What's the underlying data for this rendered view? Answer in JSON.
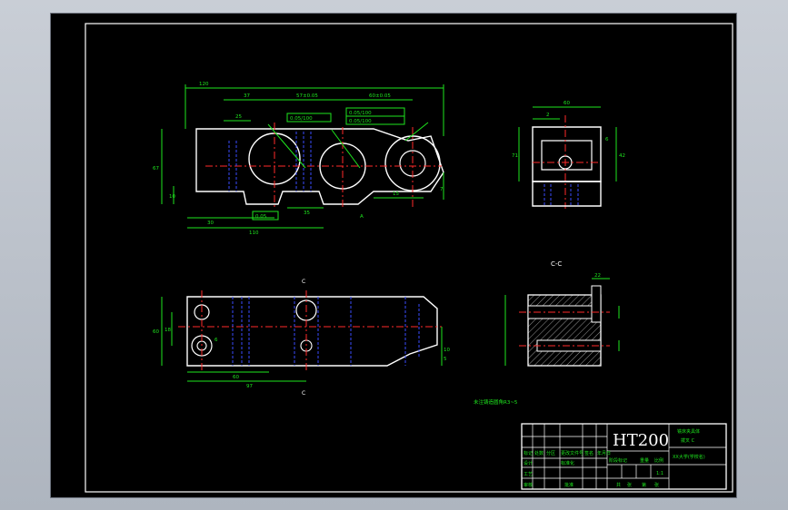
{
  "drawing": {
    "section_label": "C-C",
    "material": "HT200",
    "note": "未注铸造圆角R3~5",
    "part_view_labels": {
      "datum_a": "A",
      "datum_c": "C"
    },
    "dimensions": {
      "front": [
        "120",
        "37",
        "25",
        "57±0.05",
        "60±0.05",
        "67",
        "10",
        "30",
        "110",
        "15",
        "35",
        "7"
      ],
      "side": [
        "60",
        "2",
        "71",
        "42",
        "6"
      ],
      "plan": [
        "60",
        "6",
        "97",
        "60",
        "18",
        "10",
        "5"
      ],
      "section": [
        "22"
      ]
    },
    "tolerance_frames": [
      {
        "sym": "//",
        "value": "0.05/100",
        "datum": "A"
      },
      {
        "sym": "//",
        "value": "0.05/100",
        "datum": "A"
      },
      {
        "sym": "⊥",
        "value": "0.05/100",
        "datum": "A"
      },
      {
        "sym": "//",
        "value": "0.05",
        "datum": ""
      }
    ]
  },
  "title_block": {
    "material": "HT200",
    "part_name": "铣床夹具体",
    "drawing_no": "拨叉 C",
    "company": "XX大学(学校名)",
    "row_labels": [
      "标记",
      "处数",
      "分区",
      "更改文件号",
      "签名",
      "年月日"
    ],
    "row_labels2": [
      "设计",
      "标准化"
    ],
    "stage_labels": [
      "阶段标记",
      "重量",
      "比例"
    ],
    "bottom_labels": [
      "审核",
      "工艺",
      "批准"
    ],
    "sheet_labels": [
      "共",
      "张",
      "第",
      "张"
    ],
    "scale": "1:1"
  }
}
